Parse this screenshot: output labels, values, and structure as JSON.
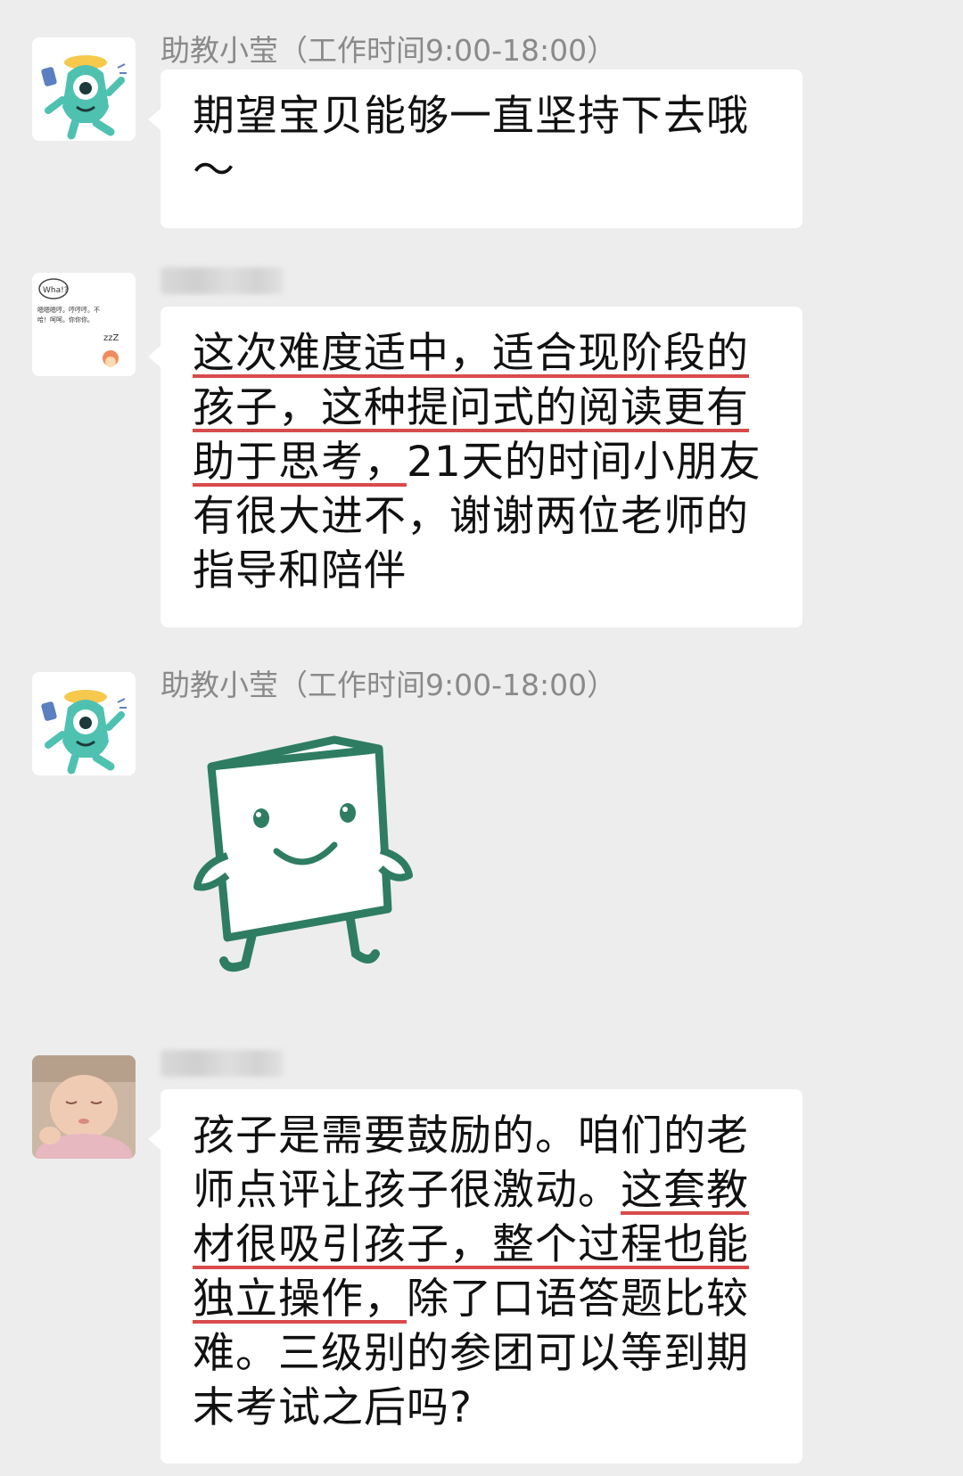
{
  "messages": [
    {
      "sender": "助教小莹（工作时间9:00-18:00）",
      "avatar": "teal-monster-avatar",
      "text": "期望宝贝能够一直坚持下去哦～"
    },
    {
      "sender": "",
      "avatar": "doodle-avatar",
      "avatar_text": {
        "bubble": "Wha!?",
        "line1": "嗯嗯嗯哼。哼哼哼。不",
        "line2": "哈！呵呵。你你你。",
        "zzz": "zzZ"
      },
      "segments": [
        {
          "text": "这次难度适中，适合现阶段的孩子，这种提问式的阅读更有助于思考，",
          "underline": true
        },
        {
          "text": "21天的时间小朋友有很大进不，谢谢两位老师的指导和陪伴",
          "underline": false
        }
      ]
    },
    {
      "sender": "助教小莹（工作时间9:00-18:00）",
      "avatar": "teal-monster-avatar",
      "sticker": "smiling-book-sticker"
    },
    {
      "sender": "",
      "avatar": "baby-photo-avatar",
      "segments": [
        {
          "text": "孩子是需要鼓励的。咱们的老师点评让孩子很激动。",
          "underline": false
        },
        {
          "text": "这套教材很吸引孩子，整个过程也能独立操作，",
          "underline": true
        },
        {
          "text": "除了口语答题比较难。三级别的参团可以等到期末考试之后吗?",
          "underline": false
        }
      ]
    }
  ],
  "colors": {
    "background": "#ededed",
    "bubble": "#ffffff",
    "highlight_underline": "#d94b4b",
    "sticker_green": "#2e7d62",
    "monster_teal": "#4fc1b0"
  }
}
